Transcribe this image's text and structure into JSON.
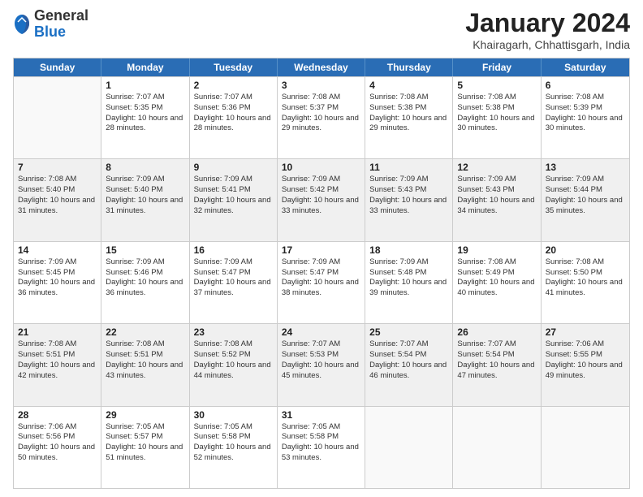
{
  "header": {
    "logo_general": "General",
    "logo_blue": "Blue",
    "title": "January 2024",
    "location": "Khairagarh, Chhattisgarh, India"
  },
  "days_of_week": [
    "Sunday",
    "Monday",
    "Tuesday",
    "Wednesday",
    "Thursday",
    "Friday",
    "Saturday"
  ],
  "weeks": [
    [
      {
        "day": "",
        "empty": true
      },
      {
        "day": "1",
        "sunrise": "7:07 AM",
        "sunset": "5:35 PM",
        "daylight": "10 hours and 28 minutes."
      },
      {
        "day": "2",
        "sunrise": "7:07 AM",
        "sunset": "5:36 PM",
        "daylight": "10 hours and 28 minutes."
      },
      {
        "day": "3",
        "sunrise": "7:08 AM",
        "sunset": "5:37 PM",
        "daylight": "10 hours and 29 minutes."
      },
      {
        "day": "4",
        "sunrise": "7:08 AM",
        "sunset": "5:38 PM",
        "daylight": "10 hours and 29 minutes."
      },
      {
        "day": "5",
        "sunrise": "7:08 AM",
        "sunset": "5:38 PM",
        "daylight": "10 hours and 30 minutes."
      },
      {
        "day": "6",
        "sunrise": "7:08 AM",
        "sunset": "5:39 PM",
        "daylight": "10 hours and 30 minutes."
      }
    ],
    [
      {
        "day": "7",
        "sunrise": "7:08 AM",
        "sunset": "5:40 PM",
        "daylight": "10 hours and 31 minutes."
      },
      {
        "day": "8",
        "sunrise": "7:09 AM",
        "sunset": "5:40 PM",
        "daylight": "10 hours and 31 minutes."
      },
      {
        "day": "9",
        "sunrise": "7:09 AM",
        "sunset": "5:41 PM",
        "daylight": "10 hours and 32 minutes."
      },
      {
        "day": "10",
        "sunrise": "7:09 AM",
        "sunset": "5:42 PM",
        "daylight": "10 hours and 33 minutes."
      },
      {
        "day": "11",
        "sunrise": "7:09 AM",
        "sunset": "5:43 PM",
        "daylight": "10 hours and 33 minutes."
      },
      {
        "day": "12",
        "sunrise": "7:09 AM",
        "sunset": "5:43 PM",
        "daylight": "10 hours and 34 minutes."
      },
      {
        "day": "13",
        "sunrise": "7:09 AM",
        "sunset": "5:44 PM",
        "daylight": "10 hours and 35 minutes."
      }
    ],
    [
      {
        "day": "14",
        "sunrise": "7:09 AM",
        "sunset": "5:45 PM",
        "daylight": "10 hours and 36 minutes."
      },
      {
        "day": "15",
        "sunrise": "7:09 AM",
        "sunset": "5:46 PM",
        "daylight": "10 hours and 36 minutes."
      },
      {
        "day": "16",
        "sunrise": "7:09 AM",
        "sunset": "5:47 PM",
        "daylight": "10 hours and 37 minutes."
      },
      {
        "day": "17",
        "sunrise": "7:09 AM",
        "sunset": "5:47 PM",
        "daylight": "10 hours and 38 minutes."
      },
      {
        "day": "18",
        "sunrise": "7:09 AM",
        "sunset": "5:48 PM",
        "daylight": "10 hours and 39 minutes."
      },
      {
        "day": "19",
        "sunrise": "7:08 AM",
        "sunset": "5:49 PM",
        "daylight": "10 hours and 40 minutes."
      },
      {
        "day": "20",
        "sunrise": "7:08 AM",
        "sunset": "5:50 PM",
        "daylight": "10 hours and 41 minutes."
      }
    ],
    [
      {
        "day": "21",
        "sunrise": "7:08 AM",
        "sunset": "5:51 PM",
        "daylight": "10 hours and 42 minutes."
      },
      {
        "day": "22",
        "sunrise": "7:08 AM",
        "sunset": "5:51 PM",
        "daylight": "10 hours and 43 minutes."
      },
      {
        "day": "23",
        "sunrise": "7:08 AM",
        "sunset": "5:52 PM",
        "daylight": "10 hours and 44 minutes."
      },
      {
        "day": "24",
        "sunrise": "7:07 AM",
        "sunset": "5:53 PM",
        "daylight": "10 hours and 45 minutes."
      },
      {
        "day": "25",
        "sunrise": "7:07 AM",
        "sunset": "5:54 PM",
        "daylight": "10 hours and 46 minutes."
      },
      {
        "day": "26",
        "sunrise": "7:07 AM",
        "sunset": "5:54 PM",
        "daylight": "10 hours and 47 minutes."
      },
      {
        "day": "27",
        "sunrise": "7:06 AM",
        "sunset": "5:55 PM",
        "daylight": "10 hours and 49 minutes."
      }
    ],
    [
      {
        "day": "28",
        "sunrise": "7:06 AM",
        "sunset": "5:56 PM",
        "daylight": "10 hours and 50 minutes."
      },
      {
        "day": "29",
        "sunrise": "7:05 AM",
        "sunset": "5:57 PM",
        "daylight": "10 hours and 51 minutes."
      },
      {
        "day": "30",
        "sunrise": "7:05 AM",
        "sunset": "5:58 PM",
        "daylight": "10 hours and 52 minutes."
      },
      {
        "day": "31",
        "sunrise": "7:05 AM",
        "sunset": "5:58 PM",
        "daylight": "10 hours and 53 minutes."
      },
      {
        "day": "",
        "empty": true
      },
      {
        "day": "",
        "empty": true
      },
      {
        "day": "",
        "empty": true
      }
    ]
  ]
}
